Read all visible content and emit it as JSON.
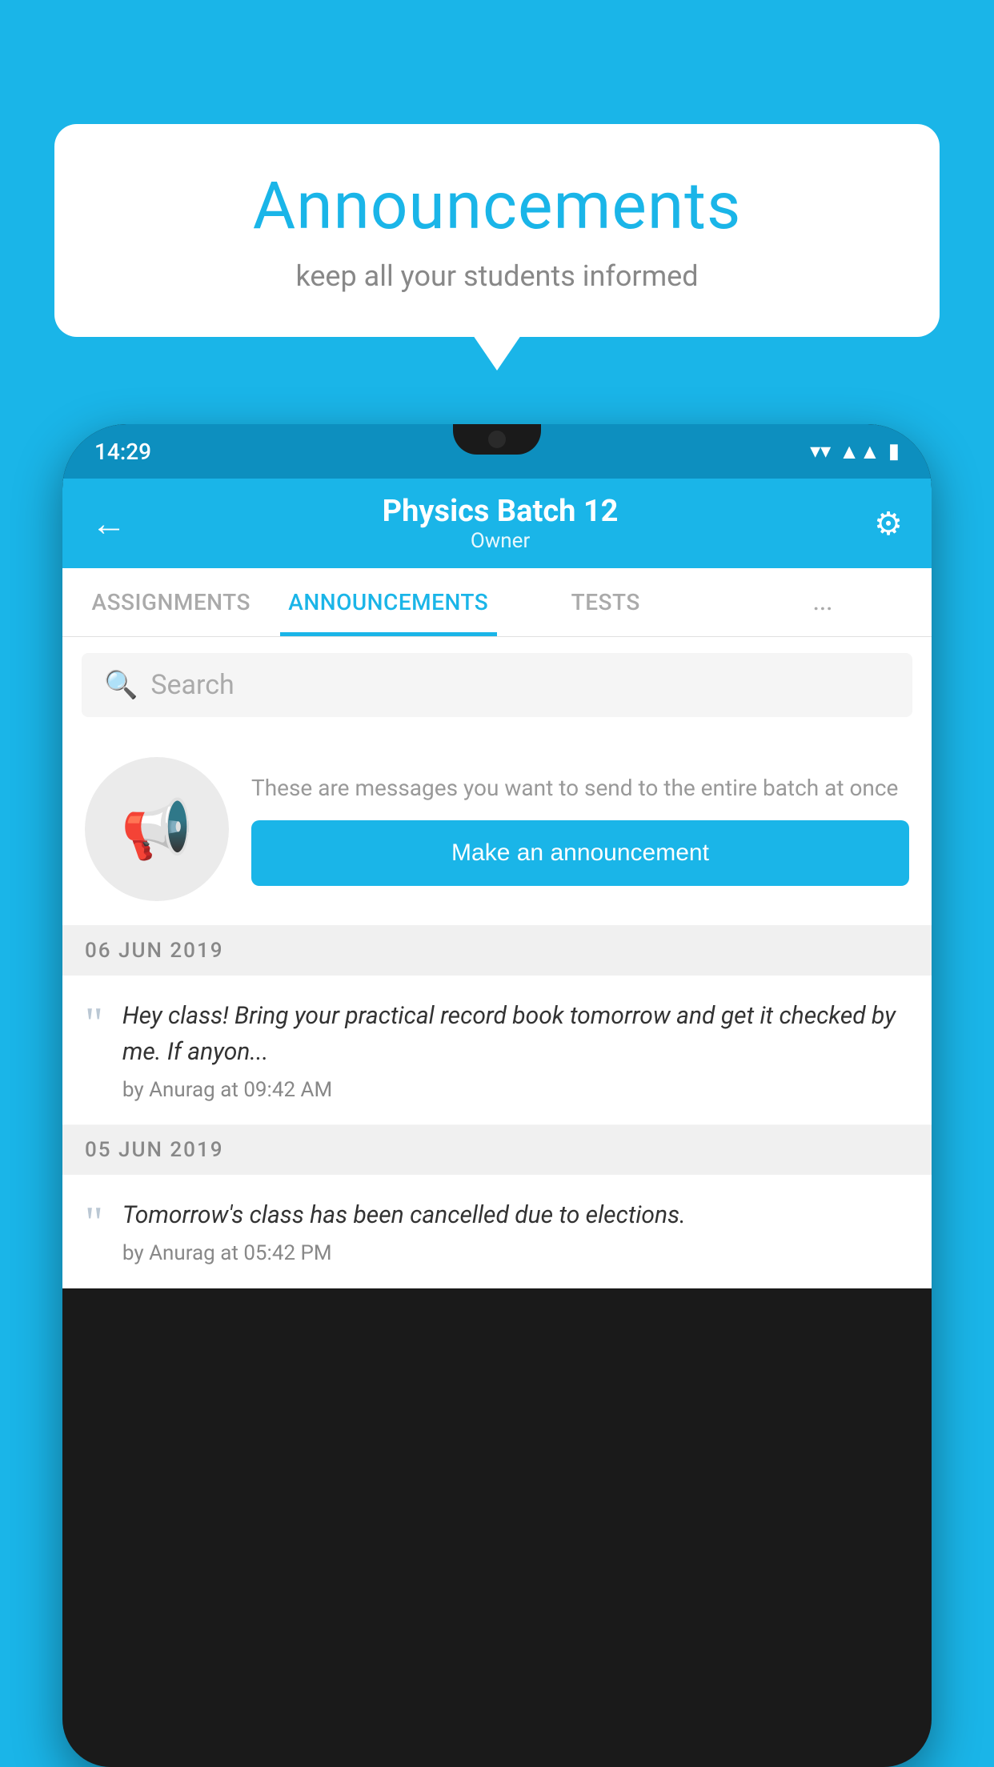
{
  "background_color": "#1ab5e8",
  "speech_bubble": {
    "title": "Announcements",
    "subtitle": "keep all your students informed"
  },
  "status_bar": {
    "time": "14:29",
    "icons": [
      "wifi",
      "signal",
      "battery"
    ]
  },
  "app_bar": {
    "title": "Physics Batch 12",
    "subtitle": "Owner",
    "back_label": "←",
    "settings_label": "⚙"
  },
  "tabs": [
    {
      "label": "ASSIGNMENTS",
      "active": false
    },
    {
      "label": "ANNOUNCEMENTS",
      "active": true
    },
    {
      "label": "TESTS",
      "active": false
    },
    {
      "label": "...",
      "active": false
    }
  ],
  "search": {
    "placeholder": "Search"
  },
  "announcement_promo": {
    "description_text": "These are messages you want to send to the entire batch at once",
    "button_label": "Make an announcement"
  },
  "announcement_list": {
    "date_group_1": {
      "date_label": "06  JUN  2019",
      "items": [
        {
          "text": "Hey class! Bring your practical record book tomorrow and get it checked by me. If anyon...",
          "meta": "by Anurag at 09:42 AM"
        }
      ]
    },
    "date_group_2": {
      "date_label": "05  JUN  2019",
      "items": [
        {
          "text": "Tomorrow's class has been cancelled due to elections.",
          "meta": "by Anurag at 05:42 PM"
        }
      ]
    }
  }
}
